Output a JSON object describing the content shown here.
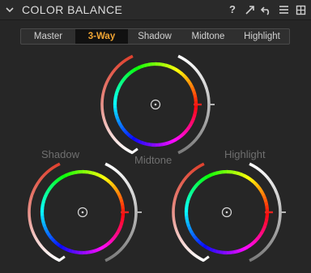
{
  "panel": {
    "title": "COLOR BALANCE"
  },
  "header_icons": [
    "help-icon",
    "expand-icon",
    "reset-icon",
    "menu-icon",
    "preset-icon"
  ],
  "header_glyphs": {
    "help": "?"
  },
  "tabs": [
    {
      "label": "Master",
      "active": false
    },
    {
      "label": "3-Way",
      "active": true
    },
    {
      "label": "Shadow",
      "active": false
    },
    {
      "label": "Midtone",
      "active": false
    },
    {
      "label": "Highlight",
      "active": false
    }
  ],
  "wheels": {
    "midtone": {
      "label": "Midtone"
    },
    "shadow": {
      "label": "Shadow"
    },
    "highlight": {
      "label": "Highlight"
    }
  },
  "colors": {
    "accent": "#f0a534",
    "indicator": "#e8231f",
    "label_dim": "#6f6f6f",
    "background": "#262626"
  }
}
